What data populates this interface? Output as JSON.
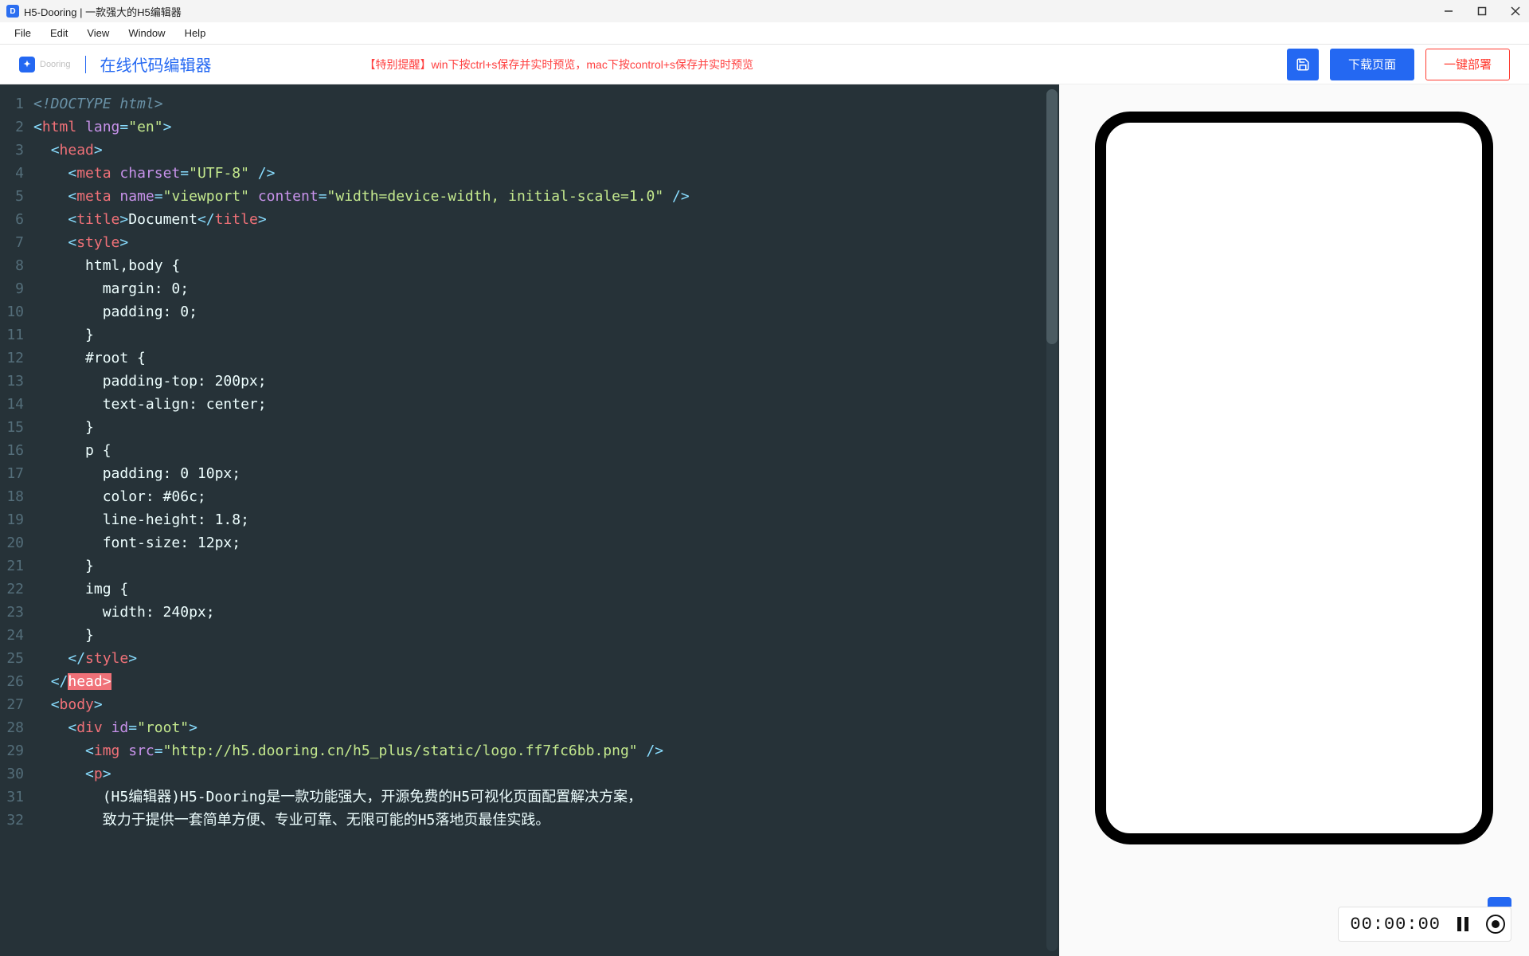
{
  "titlebar": {
    "title": "H5-Dooring | 一款强大的H5编辑器"
  },
  "menubar": {
    "items": [
      "File",
      "Edit",
      "View",
      "Window",
      "Help"
    ]
  },
  "toolbar": {
    "logo_text": "Dooring",
    "page_title": "在线代码编辑器",
    "notice": "【特别提醒】win下按ctrl+s保存并实时预览，mac下按control+s保存并实时预览",
    "download_label": "下载页面",
    "deploy_label": "一键部署"
  },
  "editor": {
    "line_count": 32,
    "code": {
      "l1": "<!DOCTYPE html>",
      "l2_tag": "html",
      "l2_attr": "lang",
      "l2_val": "\"en\"",
      "l3_tag": "head",
      "l4_tag": "meta",
      "l4_attr": "charset",
      "l4_val": "\"UTF-8\"",
      "l5_tag": "meta",
      "l5_attr1": "name",
      "l5_val1": "\"viewport\"",
      "l5_attr2": "content",
      "l5_val2": "\"width=device-width, initial-scale=1.0\"",
      "l6_tag": "title",
      "l6_text": "Document",
      "l7_tag": "style",
      "css": [
        "      html,body {",
        "        margin: 0;",
        "        padding: 0;",
        "      }",
        "      #root {",
        "        padding-top: 200px;",
        "        text-align: center;",
        "      }",
        "      p {",
        "        padding: 0 10px;",
        "        color: #06c;",
        "        line-height: 1.8;",
        "        font-size: 12px;",
        "      }",
        "      img {",
        "        width: 240px;",
        "      }"
      ],
      "l25_tag": "style",
      "l26_tag": "head",
      "l27_tag": "body",
      "l28_tag": "div",
      "l28_attr": "id",
      "l28_val": "\"root\"",
      "l29_tag": "img",
      "l29_attr": "src",
      "l29_val": "\"http://h5.dooring.cn/h5_plus/static/logo.ff7fc6bb.png\"",
      "l30_tag": "p",
      "l31_text": "        (H5编辑器)H5-Dooring是一款功能强大，开源免费的H5可视化页面配置解决方案，",
      "l32_text": "        致力于提供一套简单方便、专业可靠、无限可能的H5落地页最佳实践。"
    }
  },
  "footer": {
    "timer": "00:00:00"
  }
}
